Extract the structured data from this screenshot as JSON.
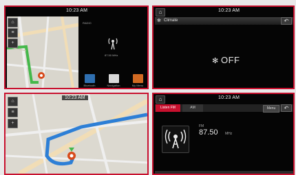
{
  "panel1": {
    "clock": "10:23 AM",
    "radio_band": "RADIO",
    "freq": "87.50 MHz",
    "apps": [
      {
        "label": "Bluetooth",
        "icon": "bluetooth-icon",
        "color": "#2f6fb0"
      },
      {
        "label": "Navigation",
        "icon": "navigation-icon",
        "color": "#d9d9d9"
      },
      {
        "label": "My Menu",
        "icon": "my-menu-icon",
        "color": "#d26a22"
      }
    ]
  },
  "panel2": {
    "clock": "10:23 AM",
    "title": "Climate",
    "status": "OFF"
  },
  "panel3": {
    "clock": "10:23 AM"
  },
  "panel4": {
    "clock": "10:23 AM",
    "tabs": [
      "Listen FM",
      "AM"
    ],
    "menu": "Menu",
    "band": "FM",
    "freq": "87.50",
    "unit": "MHz"
  },
  "colors": {
    "accent": "#c8102e",
    "route": "#2d7fd6",
    "route_green": "#44b84a"
  }
}
